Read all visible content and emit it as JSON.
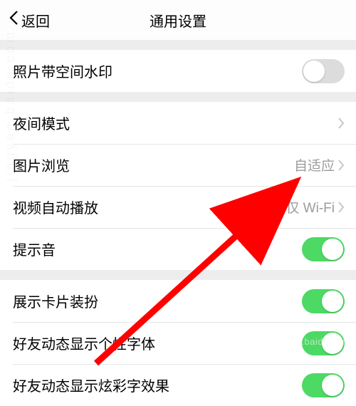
{
  "header": {
    "back_label": "返回",
    "title": "通用设置"
  },
  "groups": [
    {
      "rows": [
        {
          "label": "照片带空间水印",
          "type": "switch",
          "on": false
        }
      ]
    },
    {
      "rows": [
        {
          "label": "夜间模式",
          "type": "nav",
          "value": ""
        },
        {
          "label": "图片浏览",
          "type": "nav",
          "value": "自适应"
        },
        {
          "label": "视频自动播放",
          "type": "nav",
          "value": "仅 Wi-Fi"
        },
        {
          "label": "提示音",
          "type": "switch",
          "on": true
        }
      ]
    },
    {
      "rows": [
        {
          "label": "展示卡片装扮",
          "type": "switch",
          "on": true
        },
        {
          "label": "好友动态显示个性字体",
          "type": "switch",
          "on": true
        },
        {
          "label": "好友动态显示炫彩字效果",
          "type": "switch",
          "on": true
        }
      ]
    }
  ],
  "watermark": {
    "line1": "Baidu 经验",
    "line2": "jingyan.baidu.com"
  },
  "side_watermark": "jingyan.baidu.com"
}
